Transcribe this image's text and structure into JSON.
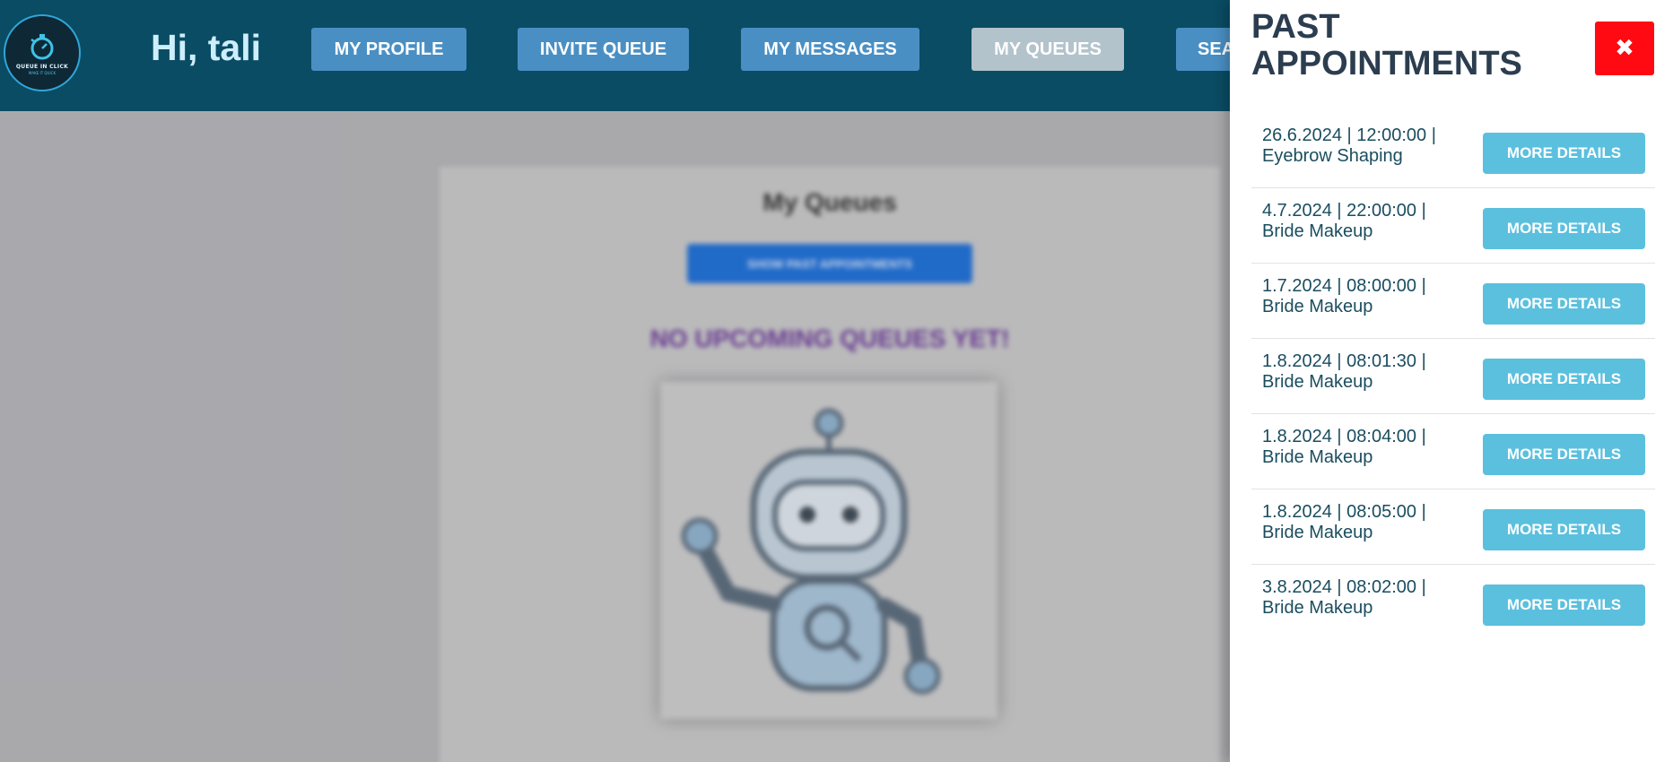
{
  "header": {
    "logo": {
      "text": "QUEUE IN CLICK",
      "subtext": "MAKE IT QUICK"
    },
    "greeting": "Hi, tali",
    "nav": [
      {
        "label": "MY PROFILE",
        "active": false
      },
      {
        "label": "INVITE QUEUE",
        "active": false
      },
      {
        "label": "MY MESSAGES",
        "active": false
      },
      {
        "label": "MY QUEUES",
        "active": true
      },
      {
        "label": "SEA",
        "active": false
      }
    ]
  },
  "main": {
    "title": "My Queues",
    "show_past_button": "SHOW PAST APPOINTMENTS",
    "empty_message": "NO UPCOMING QUEUES YET!"
  },
  "panel": {
    "title": "PAST APPOINTMENTS",
    "close_label": "✖",
    "details_label": "MORE DETAILS",
    "appointments": [
      {
        "line1": "26.6.2024 | 12:00:00 |",
        "line2": "Eyebrow Shaping"
      },
      {
        "line1": "4.7.2024 | 22:00:00 |",
        "line2": "Bride Makeup"
      },
      {
        "line1": "1.7.2024 | 08:00:00 |",
        "line2": "Bride Makeup"
      },
      {
        "line1": "1.8.2024 | 08:01:30 |",
        "line2": "Bride Makeup"
      },
      {
        "line1": "1.8.2024 | 08:04:00 |",
        "line2": "Bride Makeup"
      },
      {
        "line1": "1.8.2024 | 08:05:00 |",
        "line2": "Bride Makeup"
      },
      {
        "line1": "3.8.2024 | 08:02:00 |",
        "line2": "Bride Makeup"
      }
    ]
  },
  "colors": {
    "header_bg": "#0a4c63",
    "nav_button": "#4a8fc4",
    "nav_active": "#b3c3cc",
    "details_button": "#5bc0de",
    "close_button": "#ff0a12"
  }
}
